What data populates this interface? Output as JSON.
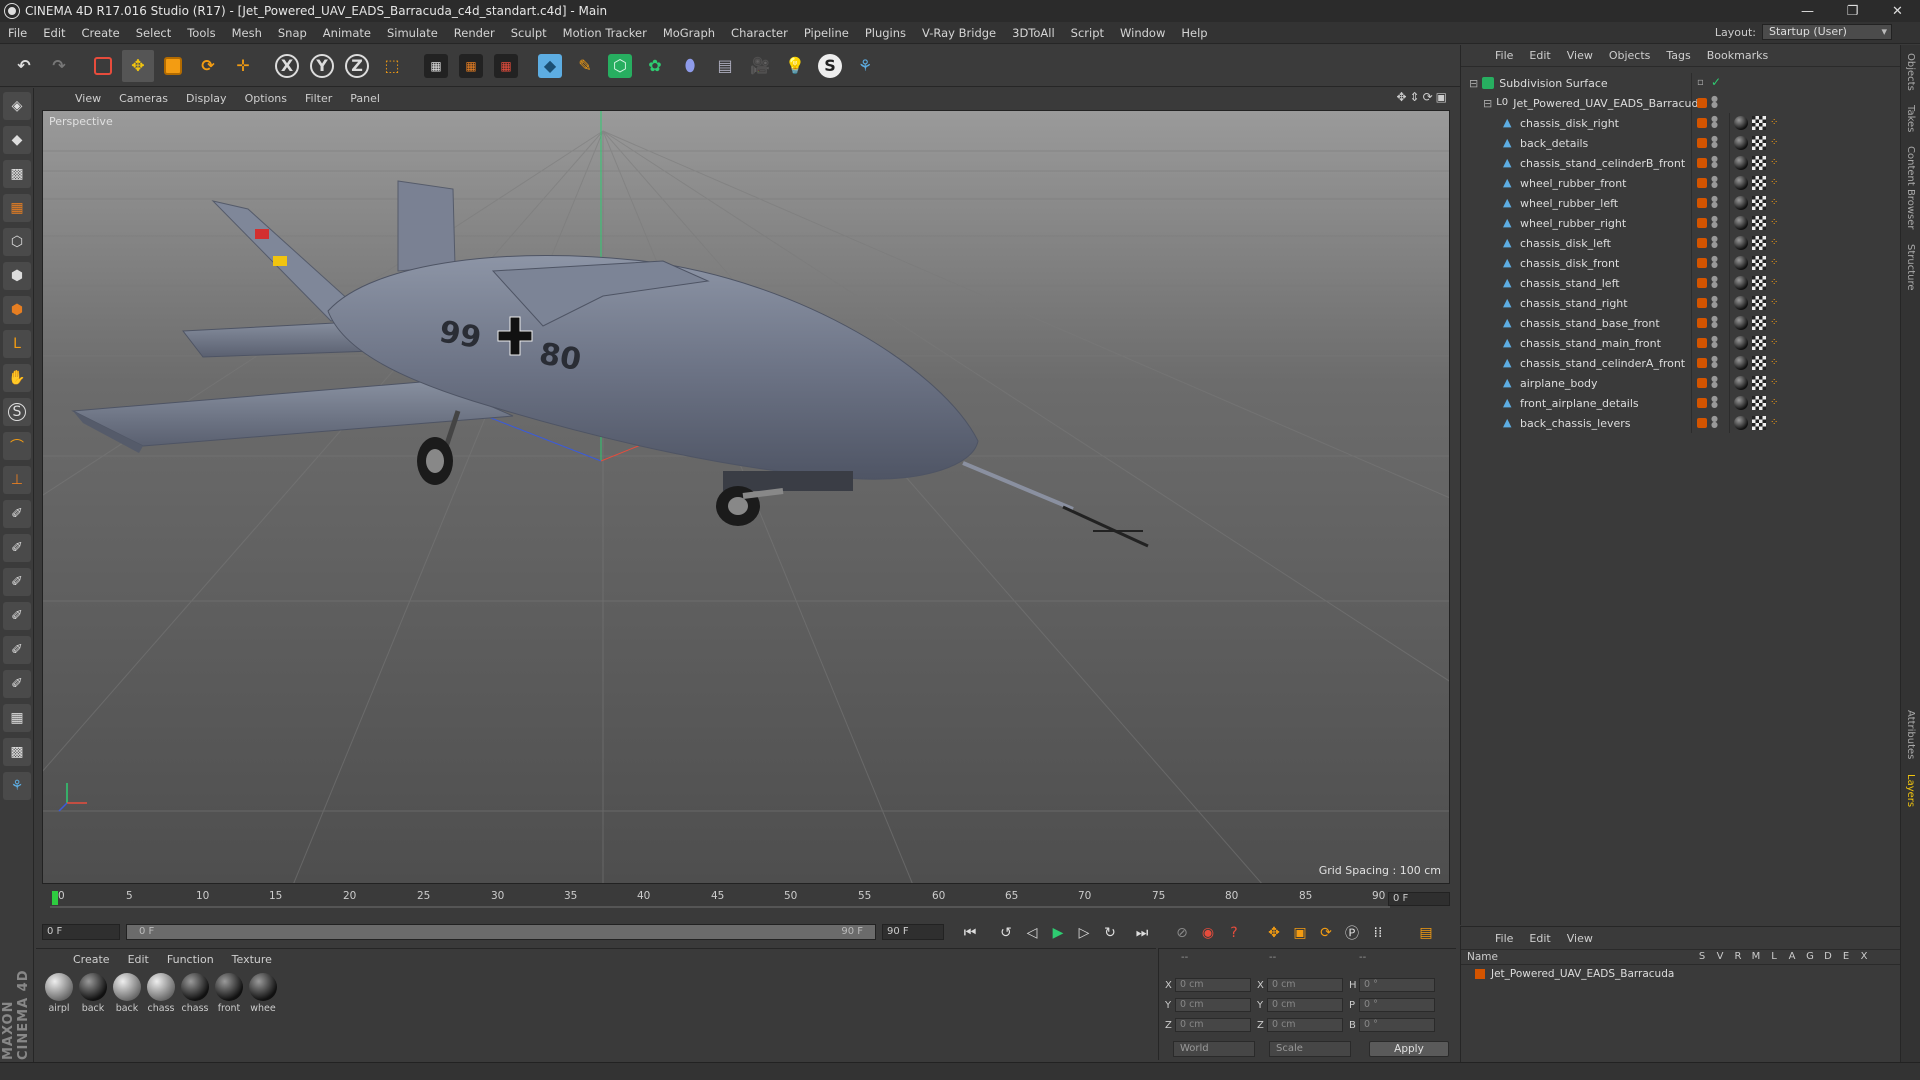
{
  "window": {
    "title": "CINEMA 4D R17.016 Studio (R17) - [Jet_Powered_UAV_EADS_Barracuda_c4d_standart.c4d] - Main",
    "controls": [
      "—",
      "❐",
      "✕"
    ]
  },
  "menu": [
    "File",
    "Edit",
    "Create",
    "Select",
    "Tools",
    "Mesh",
    "Snap",
    "Animate",
    "Simulate",
    "Render",
    "Sculpt",
    "Motion Tracker",
    "MoGraph",
    "Character",
    "Pipeline",
    "Plugins",
    "V-Ray Bridge",
    "3DToAll",
    "Script",
    "Window",
    "Help"
  ],
  "layout": {
    "label": "Layout:",
    "value": "Startup (User)"
  },
  "toolbar": {
    "axis_x": "X",
    "axis_y": "Y",
    "axis_z": "Z"
  },
  "viewport": {
    "menu": [
      "View",
      "Cameras",
      "Display",
      "Options",
      "Filter",
      "Panel"
    ],
    "label": "Perspective",
    "grid_spacing": "Grid Spacing : 100 cm",
    "decal_left": "99",
    "decal_right": "80"
  },
  "timeline": {
    "ticks": [
      "0",
      "5",
      "10",
      "15",
      "20",
      "25",
      "30",
      "35",
      "40",
      "45",
      "50",
      "55",
      "60",
      "65",
      "70",
      "75",
      "80",
      "85",
      "90"
    ],
    "current_frame": "0 F",
    "start_field": "0 F",
    "slider_start": "0 F",
    "slider_end": "90 F",
    "end_field": "90 F"
  },
  "materials": {
    "menu": [
      "Create",
      "Edit",
      "Function",
      "Texture"
    ],
    "items": [
      {
        "name": "airpl"
      },
      {
        "name": "back"
      },
      {
        "name": "back"
      },
      {
        "name": "chass"
      },
      {
        "name": "chass"
      },
      {
        "name": "front"
      },
      {
        "name": "whee"
      }
    ]
  },
  "coords": {
    "rows": [
      {
        "a1": "X",
        "v1": "0 cm",
        "a2": "X",
        "v2": "0 cm",
        "a3": "H",
        "v3": "0 °"
      },
      {
        "a1": "Y",
        "v1": "0 cm",
        "a2": "Y",
        "v2": "0 cm",
        "a3": "P",
        "v3": "0 °"
      },
      {
        "a1": "Z",
        "v1": "0 cm",
        "a2": "Z",
        "v2": "0 cm",
        "a3": "B",
        "v3": "0 °"
      }
    ],
    "header_left": "--",
    "header_mid": "--",
    "header_right": "--",
    "world": "World",
    "scale": "Scale",
    "apply": "Apply"
  },
  "objects": {
    "menu": [
      "File",
      "Edit",
      "View",
      "Objects",
      "Tags",
      "Bookmarks"
    ],
    "root": "Subdivision Surface",
    "group": "Jet_Powered_UAV_EADS_Barracuda",
    "items": [
      "chassis_disk_right",
      "back_details",
      "chassis_stand_celinderB_front",
      "wheel_rubber_front",
      "wheel_rubber_left",
      "wheel_rubber_right",
      "chassis_disk_left",
      "chassis_disk_front",
      "chassis_stand_left",
      "chassis_stand_right",
      "chassis_stand_base_front",
      "chassis_stand_main_front",
      "chassis_stand_celinderA_front",
      "airplane_body",
      "front_airplane_details",
      "back_chassis_levers"
    ]
  },
  "layers": {
    "menu": [
      "File",
      "Edit",
      "View"
    ],
    "col_name": "Name",
    "cols": [
      "S",
      "V",
      "R",
      "M",
      "L",
      "A",
      "G",
      "D",
      "E",
      "X"
    ],
    "row": "Jet_Powered_UAV_EADS_Barracuda"
  },
  "side_tabs": [
    "Objects",
    "Takes",
    "Content Browser",
    "Structure",
    "Attributes",
    "Layers"
  ],
  "colors": {
    "accent": "#d35400",
    "start_marker": "#2ecc40"
  }
}
